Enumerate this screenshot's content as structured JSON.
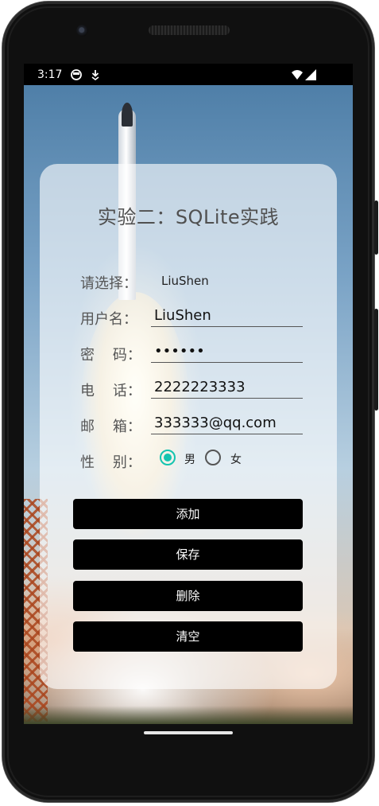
{
  "status_bar": {
    "time": "3:17",
    "icons": [
      "alert-circle-icon",
      "download-icon",
      "wifi-icon",
      "signal-icon"
    ]
  },
  "form": {
    "title": "实验二：SQLite实践",
    "spinner": {
      "label": "请选择：",
      "value": "LiuShen"
    },
    "username": {
      "label": "用户名：",
      "value": "LiuShen"
    },
    "password": {
      "label": "密    码：",
      "value": "••••••"
    },
    "phone": {
      "label": "电    话：",
      "value": "2222223333"
    },
    "email": {
      "label": "邮    箱：",
      "value": "333333@qq.com"
    },
    "gender": {
      "label": "性    别：",
      "options": [
        "男",
        "女"
      ],
      "selected": "男"
    },
    "buttons": {
      "add": "添加",
      "save": "保存",
      "delete": "删除",
      "clear": "清空"
    }
  },
  "colors": {
    "accent": "#14c4b0",
    "button_bg": "#000000",
    "button_text": "#ffffff"
  }
}
